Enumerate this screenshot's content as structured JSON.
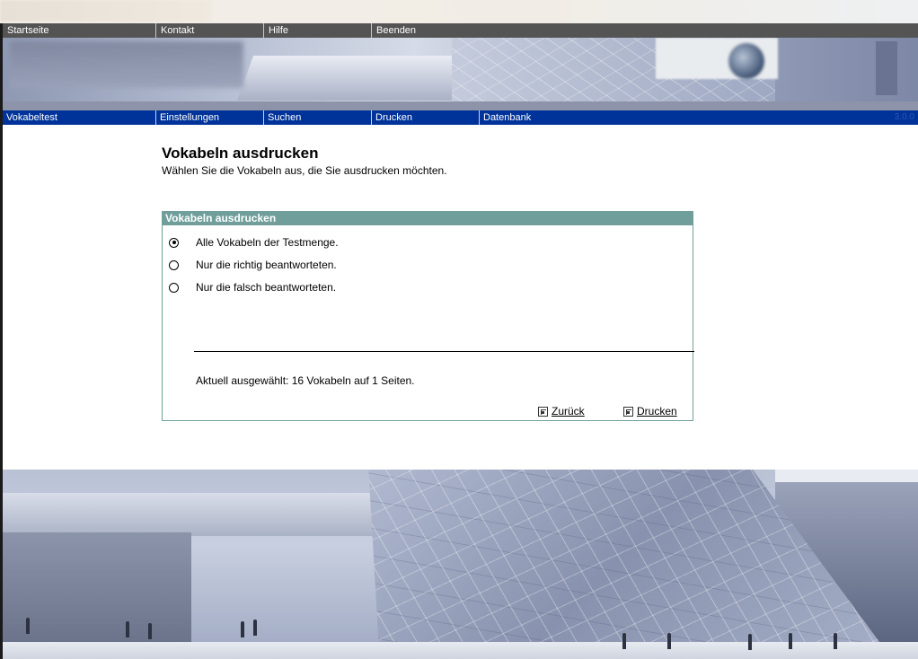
{
  "top_nav": {
    "items": [
      {
        "label": "Startseite"
      },
      {
        "label": "Kontakt"
      },
      {
        "label": "Hilfe"
      },
      {
        "label": "Beenden"
      }
    ]
  },
  "main_nav": {
    "items": [
      {
        "label": "Vokabeltest"
      },
      {
        "label": "Einstellungen"
      },
      {
        "label": "Suchen"
      },
      {
        "label": "Drucken"
      },
      {
        "label": "Datenbank"
      }
    ],
    "version": "3.0.0"
  },
  "page": {
    "title": "Vokabeln ausdrucken",
    "subtitle": "Wählen Sie die Vokabeln aus, die Sie ausdrucken möchten."
  },
  "panel": {
    "header": "Vokabeln ausdrucken",
    "options": [
      {
        "label": "Alle Vokabeln der Testmenge.",
        "selected": true
      },
      {
        "label": "Nur die richtig beantworteten.",
        "selected": false
      },
      {
        "label": "Nur die falsch beantworteten.",
        "selected": false
      }
    ],
    "summary": "Aktuell ausgewählt: 16 Vokabeln auf 1 Seiten.",
    "back_label": "Zurück",
    "print_label": "Drucken"
  },
  "colors": {
    "top_nav_bg": "#545454",
    "main_nav_bg": "#00339a",
    "panel_accent": "#6f9e9b"
  }
}
